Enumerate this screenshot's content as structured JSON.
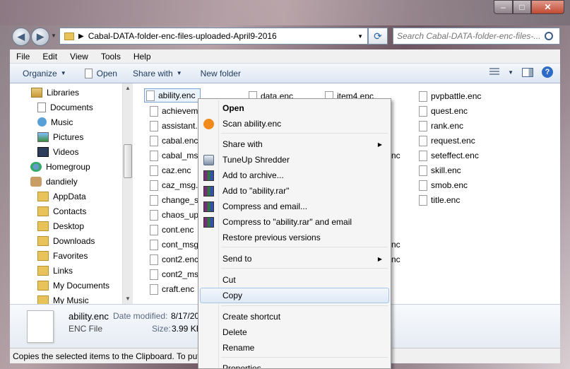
{
  "window": {
    "controls": {
      "minimize": "–",
      "maximize": "□",
      "close": "✕"
    }
  },
  "addressbar": {
    "path": "Cabal-DATA-folder-enc-files-uploaded-April9-2016",
    "search_placeholder": "Search Cabal-DATA-folder-enc-files-..."
  },
  "menubar": [
    "File",
    "Edit",
    "View",
    "Tools",
    "Help"
  ],
  "toolbar": {
    "organize": "Organize",
    "open": "Open",
    "share_with": "Share with",
    "new_folder": "New folder"
  },
  "navpane": {
    "items": [
      {
        "label": "Libraries",
        "icon": "libraries-icon"
      },
      {
        "label": "Documents",
        "icon": "documents-icon"
      },
      {
        "label": "Music",
        "icon": "music-icon"
      },
      {
        "label": "Pictures",
        "icon": "pictures-icon"
      },
      {
        "label": "Videos",
        "icon": "videos-icon"
      },
      {
        "label": "Homegroup",
        "icon": "homegroup-icon"
      },
      {
        "label": "dandiely",
        "icon": "user-icon"
      },
      {
        "label": "AppData",
        "icon": "folder-icon"
      },
      {
        "label": "Contacts",
        "icon": "folder-icon"
      },
      {
        "label": "Desktop",
        "icon": "folder-icon"
      },
      {
        "label": "Downloads",
        "icon": "folder-icon"
      },
      {
        "label": "Favorites",
        "icon": "folder-icon"
      },
      {
        "label": "Links",
        "icon": "folder-icon"
      },
      {
        "label": "My Documents",
        "icon": "folder-icon"
      },
      {
        "label": "My Music",
        "icon": "folder-icon"
      }
    ]
  },
  "files": {
    "col1": [
      "ability.enc",
      "achievem",
      "assistant.e",
      "cabal.enc",
      "cabal_msg",
      "caz.enc",
      "caz_msg.e",
      "change_sk",
      "chaos_upg",
      "cont.enc",
      "cont_msg",
      "cont2.enc",
      "cont2_ms",
      "craft.enc"
    ],
    "col2": [
      "data.enc"
    ],
    "col3": [
      "item4.enc"
    ],
    "col3_tails": [
      "nc",
      "nc"
    ],
    "col3_tails2": [
      "nc",
      "nc"
    ],
    "col4": [
      "pvpbattle.enc",
      "quest.enc",
      "rank.enc",
      "request.enc",
      "seteffect.enc",
      "skill.enc",
      "smob.enc",
      "title.enc"
    ]
  },
  "details": {
    "name": "ability.enc",
    "type": "ENC File",
    "date_label": "Date modified:",
    "date_value": "8/17/20",
    "size_label": "Size:",
    "size_value": "3.99 KE"
  },
  "statusbar": {
    "text": "Copies the selected items to the Clipboard. To put"
  },
  "context_menu": {
    "open": "Open",
    "scan": "Scan ability.enc",
    "share_with": "Share with",
    "tuneup": "TuneUp Shredder",
    "add_archive": "Add to archive...",
    "add_rar": "Add to \"ability.rar\"",
    "compress_email": "Compress and email...",
    "compress_rar_email": "Compress to \"ability.rar\" and email",
    "restore": "Restore previous versions",
    "send_to": "Send to",
    "cut": "Cut",
    "copy": "Copy",
    "create_shortcut": "Create shortcut",
    "delete": "Delete",
    "rename": "Rename",
    "properties": "Properties"
  }
}
